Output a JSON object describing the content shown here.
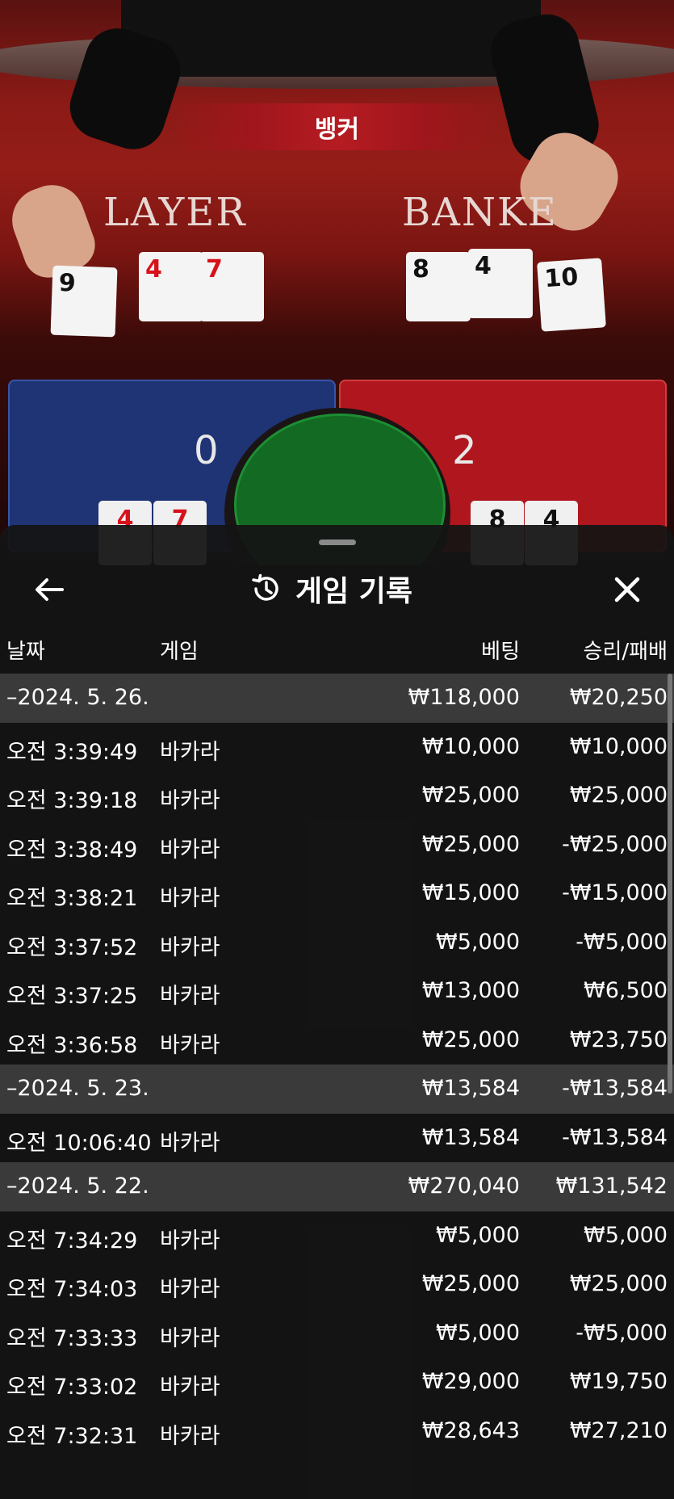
{
  "scene": {
    "win_banner": "뱅커",
    "player_label": "LAYER",
    "banker_label": "BANKE",
    "player_cards": [
      "9",
      "4",
      "7"
    ],
    "banker_cards": [
      "8",
      "4",
      "10"
    ],
    "player_score": "0",
    "banker_score": "2",
    "player_mini_cards": [
      "4",
      "7"
    ],
    "banker_mini_cards": [
      "8",
      "4"
    ]
  },
  "sheet": {
    "title": "게임 기록",
    "columns": {
      "date": "날짜",
      "game": "게임",
      "bet": "베팅",
      "result": "승리/패배"
    },
    "rows": [
      {
        "type": "date",
        "time": "–2024. 5. 26.",
        "game": "",
        "bet": "₩118,000",
        "result": "₩20,250"
      },
      {
        "type": "entry",
        "time": "오전 3:39:49",
        "game": "바카라",
        "bet": "₩10,000",
        "result": "₩10,000"
      },
      {
        "type": "entry",
        "time": "오전 3:39:18",
        "game": "바카라",
        "bet": "₩25,000",
        "result": "₩25,000"
      },
      {
        "type": "entry",
        "time": "오전 3:38:49",
        "game": "바카라",
        "bet": "₩25,000",
        "result": "-₩25,000"
      },
      {
        "type": "entry",
        "time": "오전 3:38:21",
        "game": "바카라",
        "bet": "₩15,000",
        "result": "-₩15,000"
      },
      {
        "type": "entry",
        "time": "오전 3:37:52",
        "game": "바카라",
        "bet": "₩5,000",
        "result": "-₩5,000"
      },
      {
        "type": "entry",
        "time": "오전 3:37:25",
        "game": "바카라",
        "bet": "₩13,000",
        "result": "₩6,500"
      },
      {
        "type": "entry",
        "time": "오전 3:36:58",
        "game": "바카라",
        "bet": "₩25,000",
        "result": "₩23,750"
      },
      {
        "type": "date",
        "time": "–2024. 5. 23.",
        "game": "",
        "bet": "₩13,584",
        "result": "-₩13,584"
      },
      {
        "type": "entry",
        "time": "오전 10:06:40",
        "game": "바카라",
        "bet": "₩13,584",
        "result": "-₩13,584"
      },
      {
        "type": "date",
        "time": "–2024. 5. 22.",
        "game": "",
        "bet": "₩270,040",
        "result": "₩131,542"
      },
      {
        "type": "entry",
        "time": "오전 7:34:29",
        "game": "바카라",
        "bet": "₩5,000",
        "result": "₩5,000"
      },
      {
        "type": "entry",
        "time": "오전 7:34:03",
        "game": "바카라",
        "bet": "₩25,000",
        "result": "₩25,000"
      },
      {
        "type": "entry",
        "time": "오전 7:33:33",
        "game": "바카라",
        "bet": "₩5,000",
        "result": "-₩5,000"
      },
      {
        "type": "entry",
        "time": "오전 7:33:02",
        "game": "바카라",
        "bet": "₩29,000",
        "result": "₩19,750"
      },
      {
        "type": "entry",
        "time": "오전 7:32:31",
        "game": "바카라",
        "bet": "₩28,643",
        "result": "₩27,210"
      }
    ]
  },
  "icons": {
    "back": "arrow-left-icon",
    "history": "history-icon",
    "close": "close-icon"
  }
}
